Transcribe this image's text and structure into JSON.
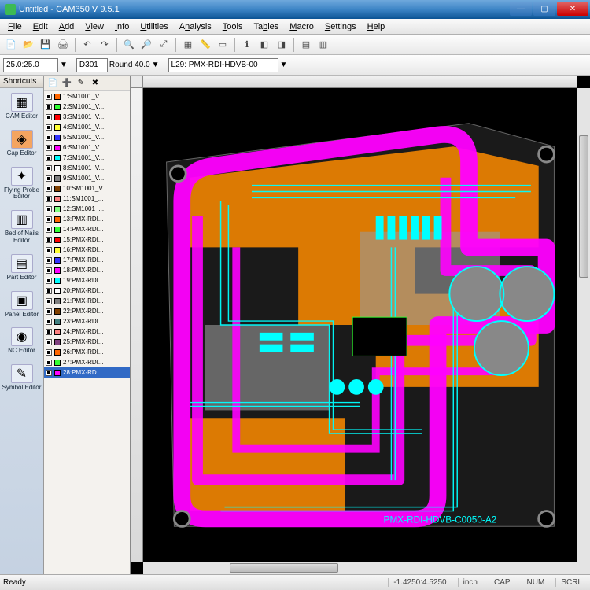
{
  "window": {
    "title": "Untitled - CAM350 V 9.5.1"
  },
  "menu": [
    "File",
    "Edit",
    "Add",
    "View",
    "Info",
    "Utilities",
    "Analysis",
    "Tools",
    "Tables",
    "Macro",
    "Settings",
    "Help"
  ],
  "toolbar2": {
    "coord": "25.0:25.0",
    "dcode": "D301",
    "dcode_desc": "Round 40.0",
    "layer_sel": "L29: PMX-RDI-HDVB-00"
  },
  "shortcuts": {
    "title": "Shortcuts",
    "items": [
      "CAM Editor",
      "Cap Editor",
      "Flying Probe Editor",
      "Bed of Nails Editor",
      "Part Editor",
      "Panel Editor",
      "NC Editor",
      "Symbol Editor"
    ]
  },
  "layers": [
    {
      "n": "1:SM1001_V...",
      "c": "#ff6600",
      "on": true
    },
    {
      "n": "2:SM1001_V...",
      "c": "#33ff33",
      "on": true
    },
    {
      "n": "3:SM1001_V...",
      "c": "#ff0000",
      "on": true
    },
    {
      "n": "4:SM1001_V...",
      "c": "#ffff33",
      "on": true
    },
    {
      "n": "5:SM1001_V...",
      "c": "#3333ff",
      "on": true
    },
    {
      "n": "6:SM1001_V...",
      "c": "#ff00ff",
      "on": true
    },
    {
      "n": "7:SM1001_V...",
      "c": "#00ffff",
      "on": true
    },
    {
      "n": "8:SM1001_V...",
      "c": "#ffffff",
      "on": true
    },
    {
      "n": "9:SM1001_V...",
      "c": "#808080",
      "on": true
    },
    {
      "n": "10:SM1001_V...",
      "c": "#804000",
      "on": true
    },
    {
      "n": "11:SM1001_...",
      "c": "#ff8080",
      "on": true
    },
    {
      "n": "12:SM1001_...",
      "c": "#80ff80",
      "on": true
    },
    {
      "n": "13:PMX-RDI...",
      "c": "#ff6600",
      "on": true
    },
    {
      "n": "14:PMX-RDI...",
      "c": "#33ff33",
      "on": true
    },
    {
      "n": "15:PMX-RDI...",
      "c": "#ff0000",
      "on": true
    },
    {
      "n": "16:PMX-RDI...",
      "c": "#ffff33",
      "on": true
    },
    {
      "n": "17:PMX-RDI...",
      "c": "#3333ff",
      "on": true
    },
    {
      "n": "18:PMX-RDI...",
      "c": "#ff00ff",
      "on": true
    },
    {
      "n": "19:PMX-RDI...",
      "c": "#00ffff",
      "on": true
    },
    {
      "n": "20:PMX-RDI...",
      "c": "#ffffff",
      "on": true
    },
    {
      "n": "21:PMX-RDI...",
      "c": "#808080",
      "on": true
    },
    {
      "n": "22:PMX-RDI...",
      "c": "#804000",
      "on": true
    },
    {
      "n": "23:PMX-RDI...",
      "c": "#408080",
      "on": true
    },
    {
      "n": "24:PMX-RDI...",
      "c": "#ff8080",
      "on": true
    },
    {
      "n": "25:PMX-RDI...",
      "c": "#804080",
      "on": true
    },
    {
      "n": "26:PMX-RDI...",
      "c": "#ff6600",
      "on": true
    },
    {
      "n": "27:PMX-RDI...",
      "c": "#33ff33",
      "on": true
    },
    {
      "n": "28:PMX-RD...",
      "c": "#ff00ff",
      "on": true,
      "sel": true
    }
  ],
  "board_label": "PMX-RDI-HDVB-C0050-A2",
  "status": {
    "ready": "Ready",
    "coords": "-1.4250:4.5250",
    "unit": "inch",
    "cap": "CAP",
    "num": "NUM",
    "scrl": "SCRL"
  },
  "colors": {
    "magenta": "#ff00ff",
    "cyan": "#00ffff",
    "orange": "#ff8c00",
    "gray": "#888888",
    "green": "#33ff33"
  }
}
